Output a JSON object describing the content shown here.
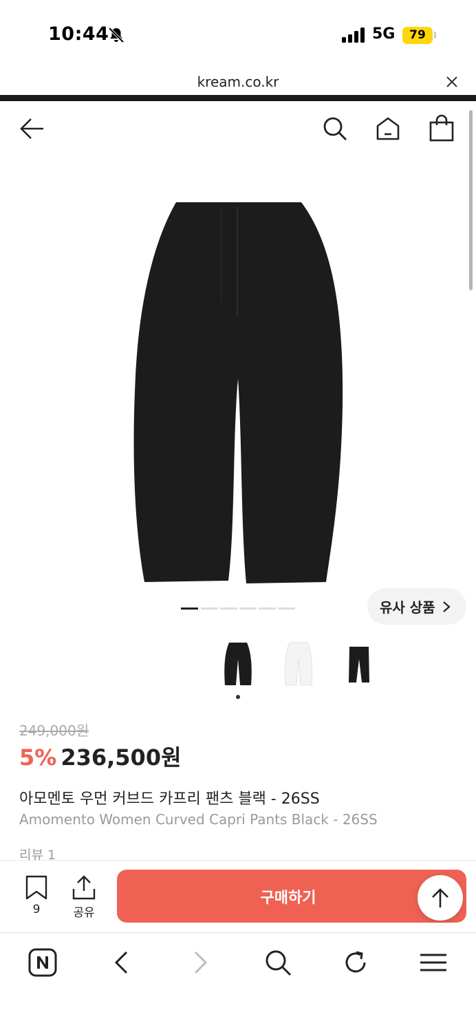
{
  "status_bar": {
    "time": "10:44",
    "network": "5G",
    "battery": "79",
    "icons": [
      "bell-slash-icon",
      "signal-bars-icon",
      "battery-icon"
    ]
  },
  "browser": {
    "url": "kream.co.kr",
    "toolbar_icons": [
      "naver-icon",
      "back-arrow-icon",
      "forward-arrow-icon",
      "search-icon",
      "refresh-icon",
      "menu-icon"
    ]
  },
  "header": {
    "icons": [
      "back-arrow-icon",
      "search-icon",
      "home-icon",
      "shopping-bag-icon"
    ]
  },
  "product": {
    "image_count": 6,
    "active_image": 1,
    "similar_label": "유사 상품",
    "thumbnails": [
      "black",
      "white",
      "black-capri"
    ],
    "original_price": "249,000원",
    "discount": "5%",
    "price": "236,500원",
    "title_ko": "아모멘토 우먼 커브드 카프리 팬츠 블랙 - 26SS",
    "title_en": "Amomento Women Curved Capri Pants Black - 26SS",
    "review_label": "리뷰 1"
  },
  "actions": {
    "bookmark_count": "9",
    "share_label": "공유",
    "buy_label": "구매하기"
  },
  "colors": {
    "accent": "#ef6253",
    "battery": "#ffd60a",
    "text": "#222222",
    "muted": "#9a9a9a"
  }
}
